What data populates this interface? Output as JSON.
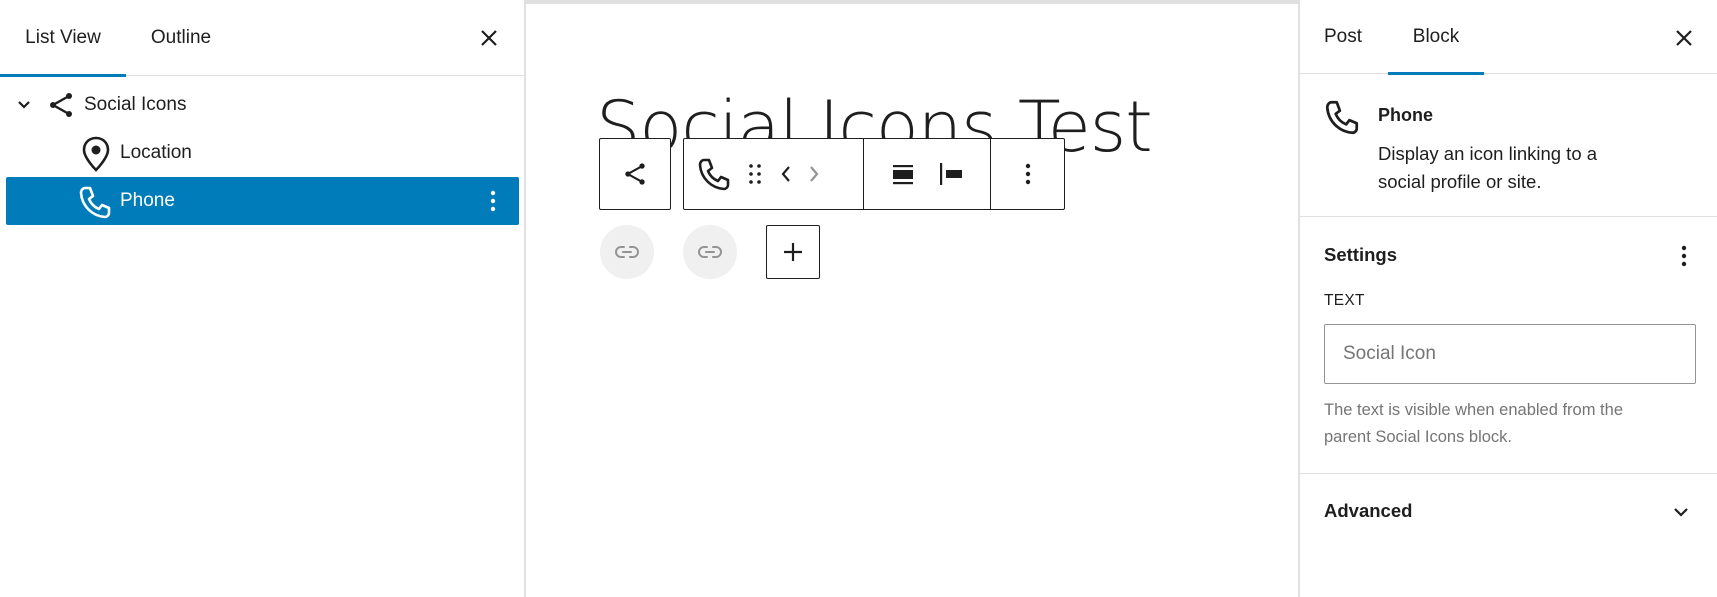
{
  "left_panel": {
    "tabs": [
      {
        "label": "List View",
        "active": true
      },
      {
        "label": "Outline",
        "active": false
      }
    ],
    "tree": [
      {
        "label": "Social Icons",
        "icon": "share-icon",
        "expanded": true
      },
      {
        "label": "Location",
        "icon": "location-pin-icon"
      },
      {
        "label": "Phone",
        "icon": "phone-icon",
        "selected": true
      }
    ]
  },
  "canvas": {
    "title": "Social Icons Test"
  },
  "sidebar": {
    "tabs": [
      {
        "label": "Post",
        "active": false
      },
      {
        "label": "Block",
        "active": true
      }
    ],
    "block_card": {
      "title": "Phone",
      "description": "Display an icon linking to a social profile or site."
    },
    "settings": {
      "title": "Settings",
      "text_label": "Text",
      "text_placeholder": "Social Icon",
      "help": "The text is visible when enabled from the parent Social Icons block."
    },
    "advanced": {
      "title": "Advanced"
    }
  },
  "colors": {
    "accent": "#007cba",
    "text": "#1e1e1e",
    "muted": "#757575",
    "border": "#e0e0e0"
  }
}
